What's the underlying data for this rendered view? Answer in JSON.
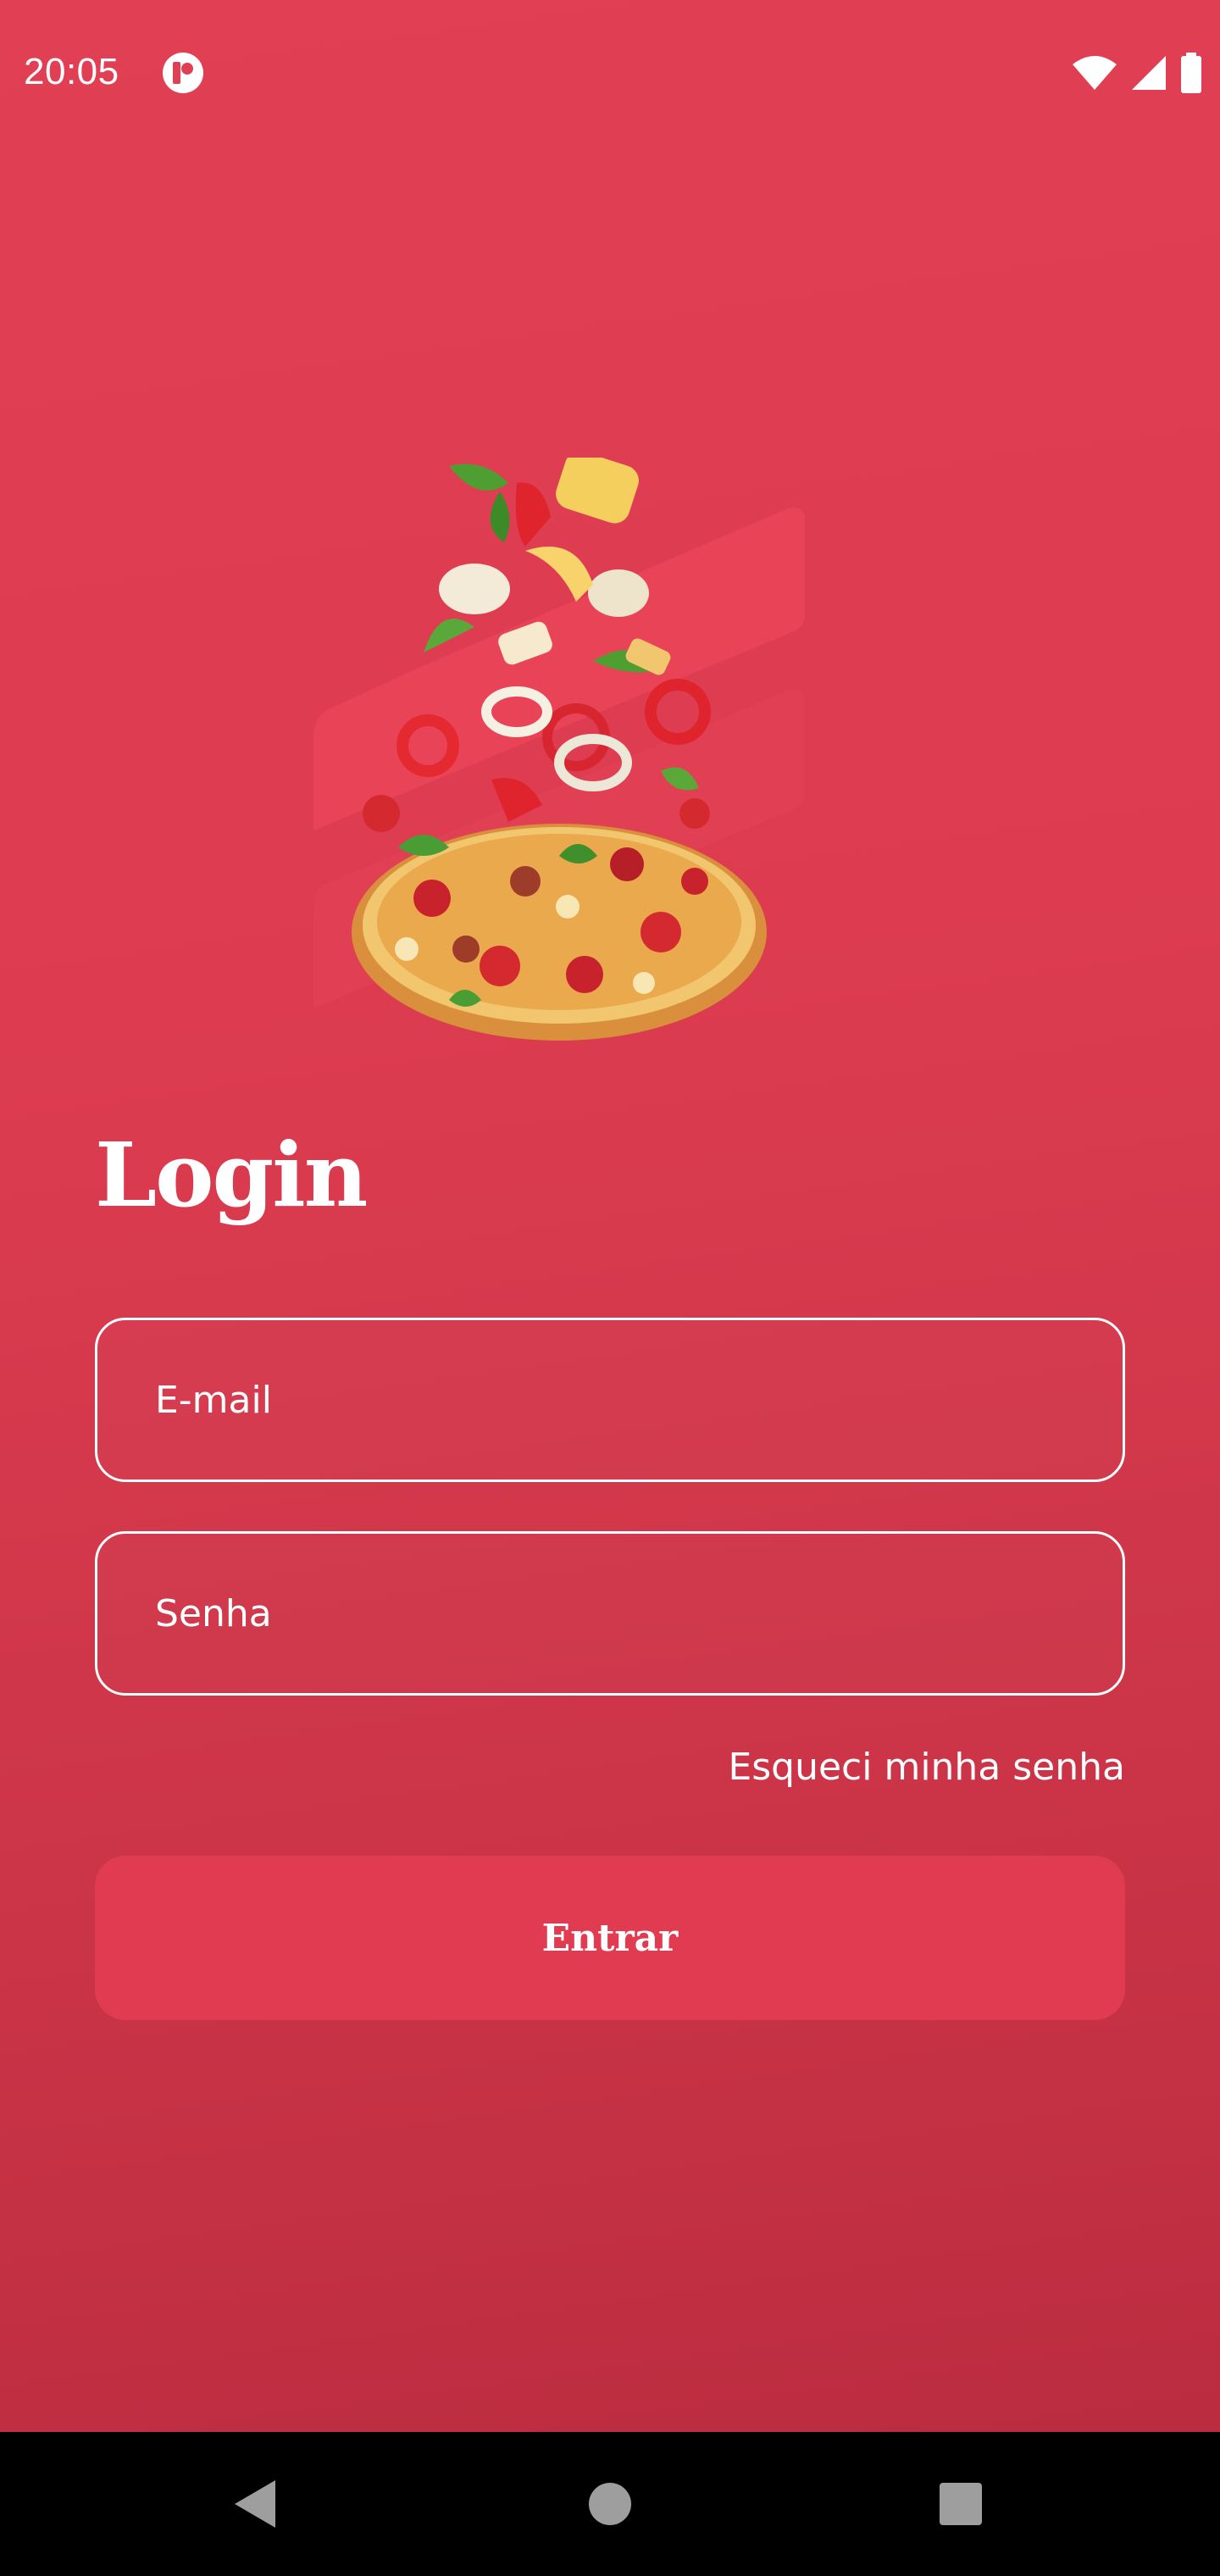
{
  "status_bar": {
    "time": "20:05",
    "app_icon": "notification-app-icon",
    "icons": [
      "wifi-icon",
      "cellular-signal-icon",
      "battery-icon"
    ]
  },
  "hero": {
    "illustration": "flying-pizza-illustration"
  },
  "login": {
    "title": "Login",
    "email_placeholder": "E-mail",
    "password_placeholder": "Senha",
    "forgot_label": "Esqueci minha senha",
    "submit_label": "Entrar"
  },
  "nav_bar": {
    "buttons": [
      "back-icon",
      "home-icon",
      "recents-icon"
    ]
  },
  "colors": {
    "background_top": "#e13f53",
    "background_bottom": "#bb2c40",
    "button": "#e03b50",
    "text": "#ffffff",
    "nav_bar": "#000000"
  }
}
